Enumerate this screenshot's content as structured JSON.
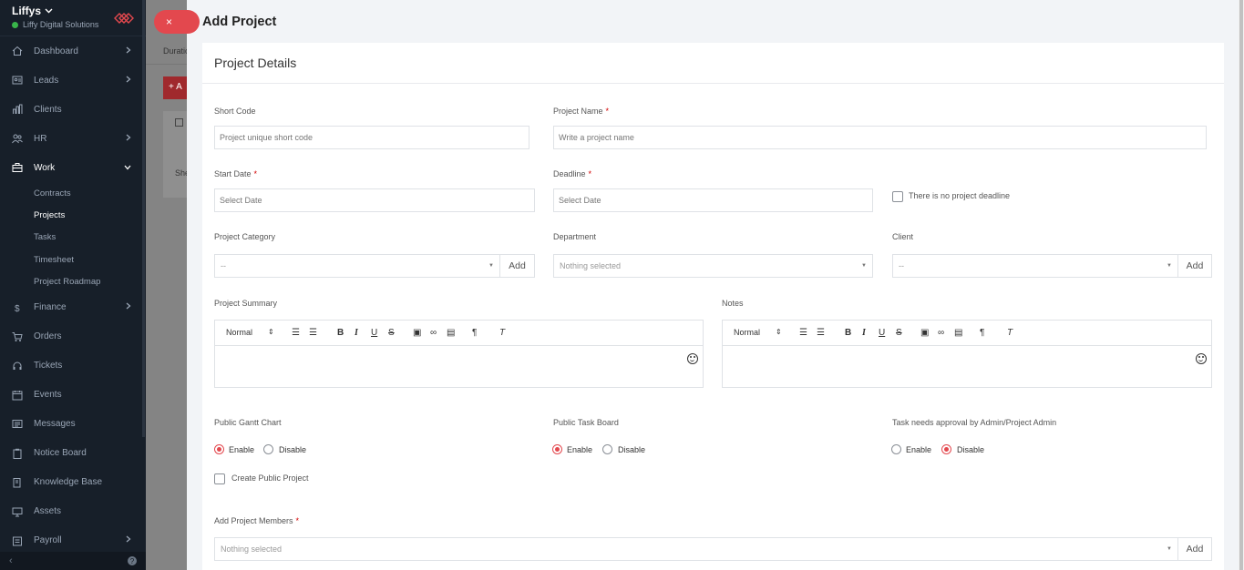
{
  "sidebar": {
    "workspace": "Liffys",
    "company": "Liffy Digital Solutions",
    "nav": [
      {
        "label": "Dashboard",
        "icon": "home-icon",
        "has_chevron": true
      },
      {
        "label": "Leads",
        "icon": "id-card-icon",
        "has_chevron": true
      },
      {
        "label": "Clients",
        "icon": "building-icon",
        "has_chevron": false
      },
      {
        "label": "HR",
        "icon": "people-icon",
        "has_chevron": true
      },
      {
        "label": "Work",
        "icon": "briefcase-icon",
        "has_chevron": true
      }
    ],
    "work_sub": [
      "Contracts",
      "Projects",
      "Tasks",
      "Timesheet",
      "Project Roadmap"
    ],
    "nav2": [
      {
        "label": "Finance",
        "icon": "dollar-icon",
        "has_chevron": true
      },
      {
        "label": "Orders",
        "icon": "cart-icon",
        "has_chevron": false
      },
      {
        "label": "Tickets",
        "icon": "headset-icon",
        "has_chevron": false
      },
      {
        "label": "Events",
        "icon": "calendar-icon",
        "has_chevron": false
      },
      {
        "label": "Messages",
        "icon": "message-icon",
        "has_chevron": false
      },
      {
        "label": "Notice Board",
        "icon": "clipboard-icon",
        "has_chevron": false
      },
      {
        "label": "Knowledge Base",
        "icon": "book-icon",
        "has_chevron": false
      },
      {
        "label": "Assets",
        "icon": "monitor-icon",
        "has_chevron": false
      },
      {
        "label": "Payroll",
        "icon": "payroll-icon",
        "has_chevron": true
      }
    ]
  },
  "background": {
    "close": "×",
    "duration": "Duratio",
    "add": "+ A",
    "row": "She"
  },
  "modal": {
    "title": "Add Project",
    "section": "Project Details",
    "fields": {
      "short_code": {
        "label": "Short Code",
        "placeholder": "Project unique short code"
      },
      "project_name": {
        "label": "Project Name",
        "placeholder": "Write a project name"
      },
      "start_date": {
        "label": "Start Date",
        "placeholder": "Select Date"
      },
      "deadline": {
        "label": "Deadline",
        "placeholder": "Select Date"
      },
      "no_deadline": "There is no project deadline",
      "category": {
        "label": "Project Category",
        "value": "--",
        "add": "Add"
      },
      "department": {
        "label": "Department",
        "value": "Nothing selected"
      },
      "client": {
        "label": "Client",
        "value": "--",
        "add": "Add"
      },
      "summary": {
        "label": "Project Summary"
      },
      "notes": {
        "label": "Notes"
      },
      "editor_format": "Normal",
      "public_gantt": {
        "label": "Public Gantt Chart",
        "enable": "Enable",
        "disable": "Disable",
        "selected": "enable"
      },
      "public_task_board": {
        "label": "Public Task Board",
        "enable": "Enable",
        "disable": "Disable",
        "selected": "enable"
      },
      "task_approval": {
        "label": "Task needs approval by Admin/Project Admin",
        "enable": "Enable",
        "disable": "Disable",
        "selected": "disable"
      },
      "create_public": "Create Public Project",
      "members": {
        "label": "Add Project Members",
        "value": "Nothing selected",
        "add": "Add"
      },
      "required_mark": "*"
    }
  },
  "colors": {
    "accent": "#e3484e",
    "sidebar": "#171f29"
  }
}
